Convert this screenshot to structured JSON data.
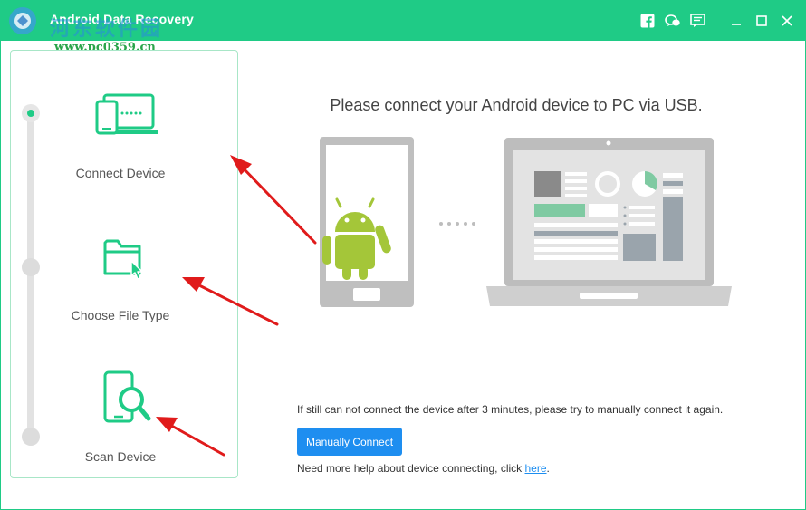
{
  "window": {
    "title": "Android Data Recovery",
    "watermark_cn": "河东软件园",
    "watermark_url": "www.pc0359.cn"
  },
  "titlebar_icons": [
    "facebook-icon",
    "chat-icon",
    "feedback-icon",
    "minimize-icon",
    "maximize-icon",
    "close-icon"
  ],
  "steps": [
    {
      "label": "Connect Device",
      "icon": "device-connect-icon",
      "active": true
    },
    {
      "label": "Choose File Type",
      "icon": "folder-select-icon",
      "active": false
    },
    {
      "label": "Scan Device",
      "icon": "scan-device-icon",
      "active": false
    }
  ],
  "main": {
    "heading": "Please connect your Android device to PC via USB.",
    "hint": "If still can not connect the device after 3 minutes, please try to manually connect it again.",
    "manual_button": "Manually Connect",
    "help_prefix": "Need more help about device connecting, click ",
    "help_link": "here",
    "help_suffix": "."
  },
  "colors": {
    "accent": "#1fcb86",
    "button": "#1e8ef0",
    "annotation_arrow": "#e01b1b",
    "android_green": "#a4c639"
  }
}
